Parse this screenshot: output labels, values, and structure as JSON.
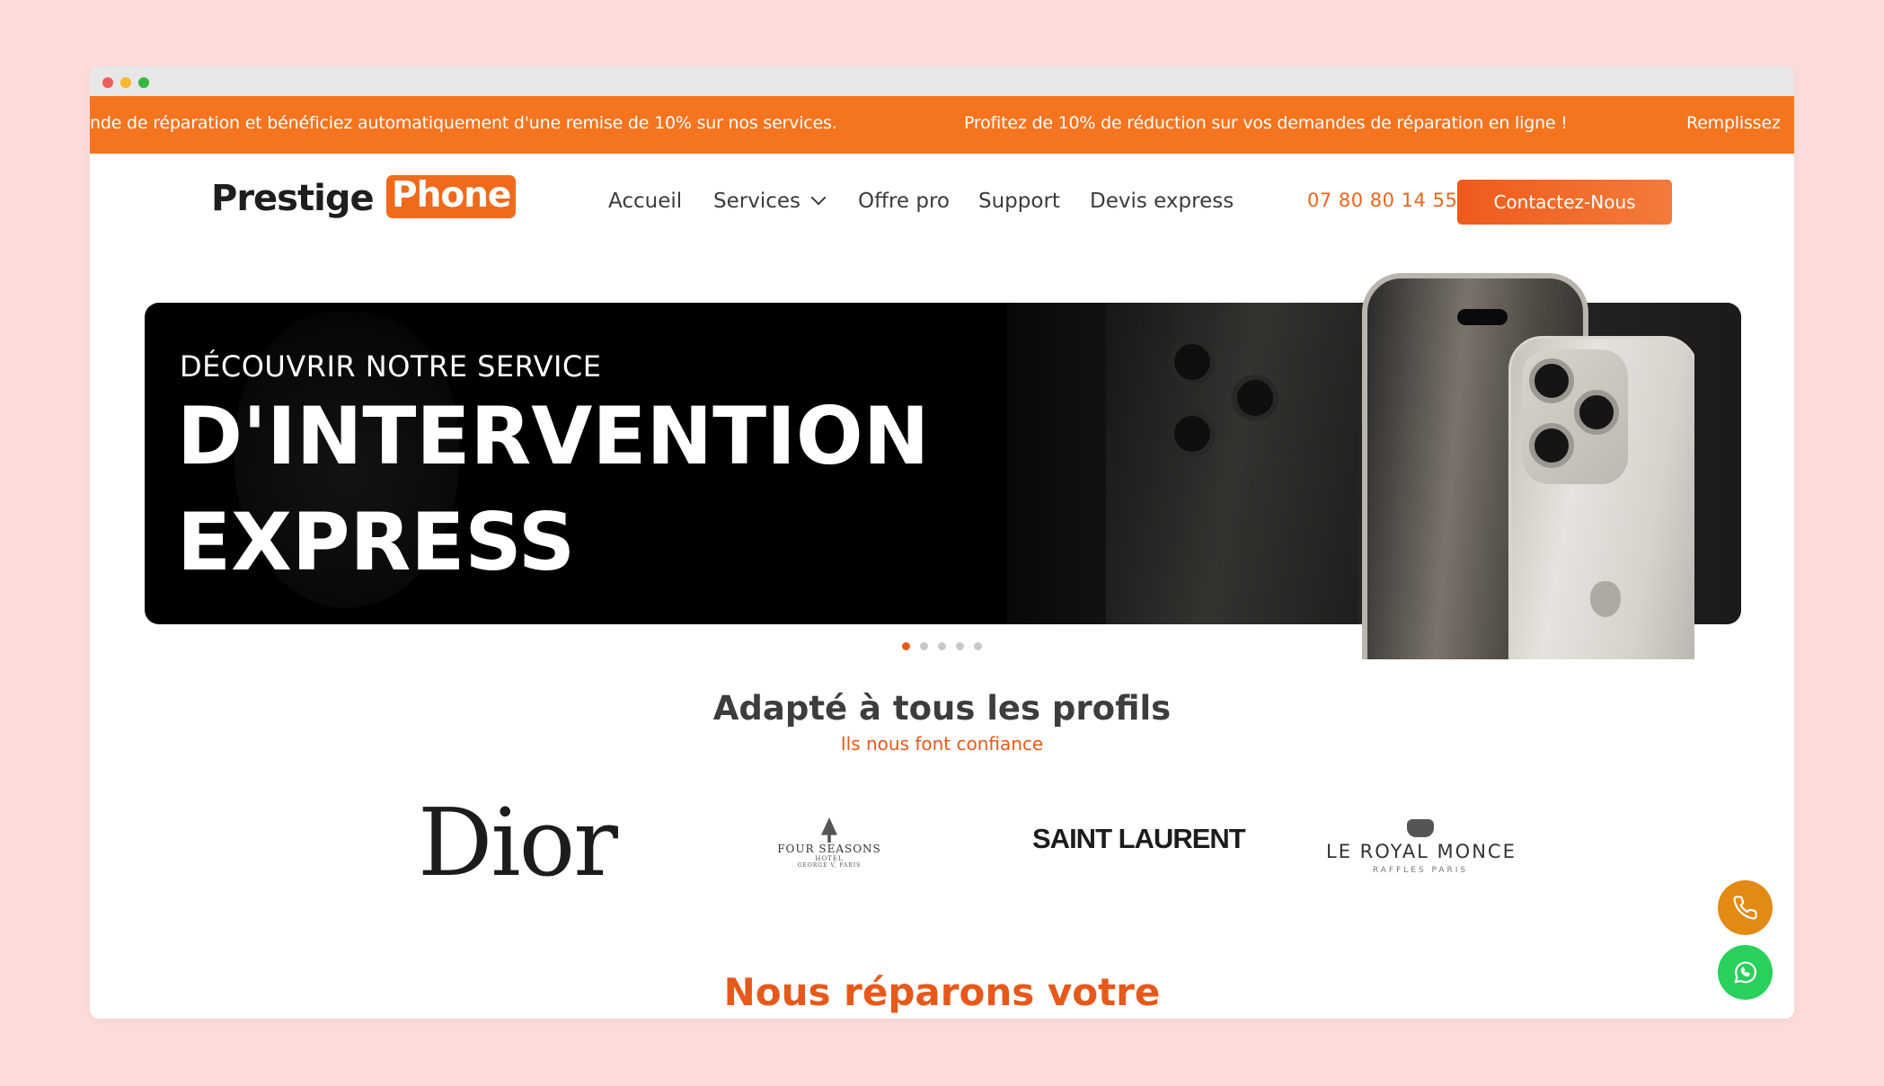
{
  "window": {
    "controls": [
      "close",
      "minimize",
      "maximize"
    ]
  },
  "promo_bar": {
    "messages": [
      "nde de réparation et bénéficiez automatiquement d'une remise de 10% sur nos services.",
      "Profitez de 10% de réduction sur vos demandes de réparation en ligne !",
      "Remplissez"
    ],
    "background": "#f57420"
  },
  "header": {
    "logo": {
      "word1": "Prestige",
      "word2": "Phone"
    },
    "nav": [
      {
        "label": "Accueil"
      },
      {
        "label": "Services",
        "has_dropdown": true
      },
      {
        "label": "Offre pro"
      },
      {
        "label": "Support"
      },
      {
        "label": "Devis express"
      }
    ],
    "phone": "07 80 80 14 55",
    "contact_button": "Contactez-Nous"
  },
  "hero": {
    "kicker": "DÉCOUVRIR NOTRE SERVICE",
    "title_line1": "D'INTERVENTION",
    "title_line2": "EXPRESS",
    "slides_total": 5,
    "active_slide": 1
  },
  "profiles": {
    "title": "Adapté à tous les profils",
    "subtitle": "Ils nous font confiance",
    "brands": {
      "dior": "Dior",
      "four_seasons": {
        "name": "FOUR SEASONS",
        "line2": "HOTEL",
        "line3": "GEORGE V, PARIS"
      },
      "saint_laurent": "SAINT LAURENT",
      "royal_monceau": {
        "name": "LE ROYAL MONCE",
        "sub": "RAFFLES PARIS"
      }
    }
  },
  "floating_actions": [
    {
      "icon": "phone-icon",
      "color": "#e28a14"
    },
    {
      "icon": "whatsapp-icon",
      "color": "#29d05c"
    }
  ],
  "repair": {
    "title": "Nous réparons votre"
  },
  "colors": {
    "accent": "#e6591b",
    "page_background": "#fcdcd9"
  }
}
